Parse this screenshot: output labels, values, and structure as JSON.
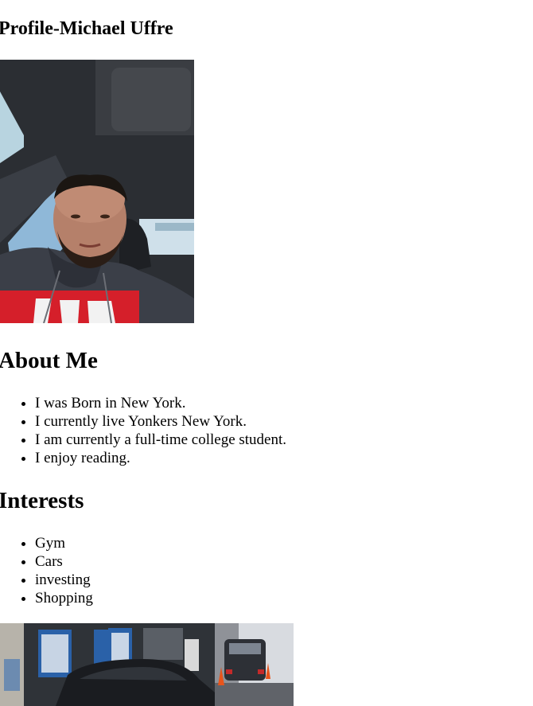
{
  "profile": {
    "title": "Profile-Michael Uffre"
  },
  "about": {
    "heading": "About Me",
    "items": [
      "I was Born in New York.",
      "I currently live Yonkers New York.",
      "I am currently a full-time college student.",
      "I enjoy reading."
    ]
  },
  "interests": {
    "heading": "Interests",
    "items": [
      "Gym",
      "Cars",
      "investing",
      "Shopping"
    ]
  },
  "colors": {
    "background": "#ffffff",
    "text": "#000000"
  }
}
